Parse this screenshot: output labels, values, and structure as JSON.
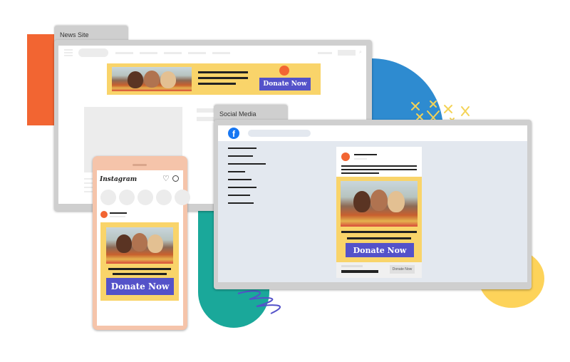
{
  "colors": {
    "orange": "#f26532",
    "blue": "#2e8bd0",
    "teal": "#1aa89a",
    "yellow": "#fdd35a",
    "banner_yellow": "#f9d46a",
    "donate_purple": "#5452c9",
    "facebook_blue": "#1877f2"
  },
  "news_site": {
    "tab_title": "News Site",
    "banner": {
      "donate_label": "Donate Now"
    }
  },
  "social_media": {
    "tab_title": "Social Media",
    "logo_icon": "facebook-icon",
    "post": {
      "donate_label": "Donate Now",
      "cta_label": "Donate Now"
    }
  },
  "instagram": {
    "app_name": "Instagram",
    "icons": [
      "heart-icon",
      "message-icon"
    ],
    "donate_label": "Donate Now"
  }
}
